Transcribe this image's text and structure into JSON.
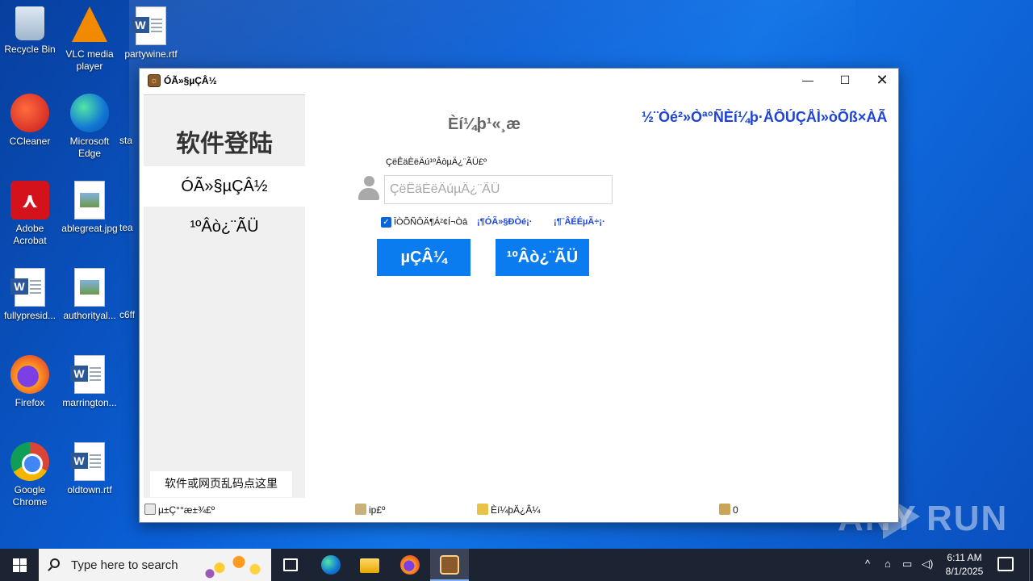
{
  "desktop": {
    "icons": [
      {
        "label": "Recycle Bin"
      },
      {
        "label": "VLC media player"
      },
      {
        "label": "partywine.rtf"
      },
      {
        "label": "CCleaner"
      },
      {
        "label": "Microsoft Edge"
      },
      {
        "label": "sta"
      },
      {
        "label": "Adobe Acrobat"
      },
      {
        "label": "ablegreat.jpg"
      },
      {
        "label": "tea"
      },
      {
        "label": "fullypresid..."
      },
      {
        "label": "authorityal..."
      },
      {
        "label": "c6ff"
      },
      {
        "label": "Firefox"
      },
      {
        "label": "marrington..."
      },
      {
        "label": "Google Chrome"
      },
      {
        "label": "oldtown.rtf"
      }
    ]
  },
  "window": {
    "title": "ÓÃ»§µÇÂ½",
    "controls": {
      "minimize": "—",
      "maximize": "☐",
      "close": "✕"
    },
    "sidebar": {
      "heading": "软件登陆",
      "nav_login": "ÓÃ»§µÇÂ½",
      "nav_buy": "¹ºÂò¿¨ÃÜ",
      "garble_help": "软件或网页乱码点这里"
    },
    "main": {
      "title": "Èí¼þ¹«¸æ",
      "marquee": "½¨Òé²»Òª°ÑÈí¼þ·ÅÔÚÇÅÌ»òÕß×ÀÃæ",
      "card_label": "ÇëÊäÈëÄú¹ºÂòµÄ¿¨ÃÜ£º",
      "card_placeholder": "ÇëÊäÈëÄúµÄ¿¨ÃÜ",
      "remember_label": "ÏÒÕÑÔÄ¶Á²¢Í¬Òâ",
      "remember_checked": "✓",
      "link_unbind": "¡¶ÓÃ»§Ð­Òé¡·",
      "link_recharge": "¡¶¨ÂÉÉµÃ÷¡·",
      "btn_login": "µÇÂ¼",
      "btn_buy": "¹ºÂò¿¨ÃÜ"
    },
    "status": [
      "µ±Ç°°æ±¾£º",
      "ip£º",
      "Èí¼þÄ¿Â¼",
      "0"
    ]
  },
  "taskbar": {
    "search_placeholder": "Type here to search",
    "tray_up": "^",
    "time": "6:11 AM",
    "date": "8/1/2025"
  },
  "watermark": {
    "left": "ANY",
    "right": "RUN"
  },
  "colors": {
    "accent_button": "#0a7cf0",
    "link": "#1d44d6",
    "desktop": "#0a5fd6"
  }
}
